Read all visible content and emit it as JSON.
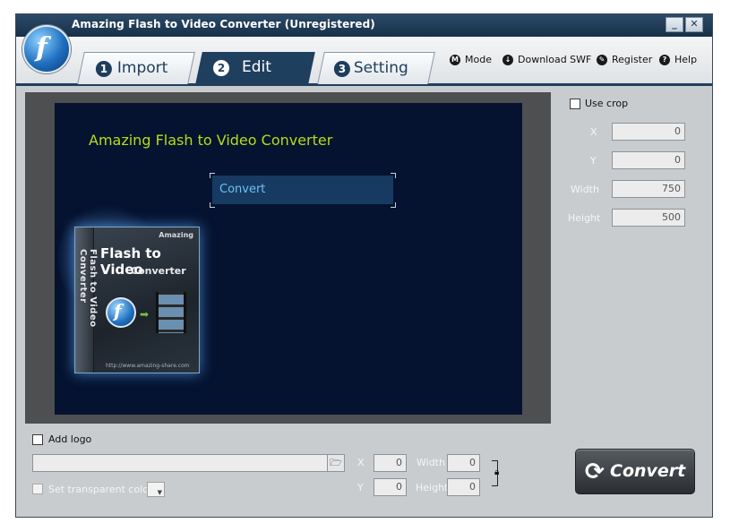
{
  "window": {
    "title": "Amazing Flash to Video Converter (Unregistered)",
    "minimize_label": "_",
    "close_label": "✕"
  },
  "tabs": [
    {
      "number": "1",
      "label": "Import"
    },
    {
      "number": "2",
      "label": "Edit"
    },
    {
      "number": "3",
      "label": "Setting"
    }
  ],
  "top_links": [
    {
      "icon": "M",
      "label": "Mode"
    },
    {
      "icon": "↓",
      "label": "Download SWF"
    },
    {
      "icon": "✎",
      "label": "Register"
    },
    {
      "icon": "?",
      "label": "Help"
    }
  ],
  "preview": {
    "stage_title": "Amazing Flash to Video Converter",
    "stage_button": "Convert",
    "box": {
      "spine": "Flash to Video Converter",
      "brand": "Amazing",
      "title": "Flash to Video",
      "subtitle": "Converter",
      "url": "http://www.amazing-share.com"
    }
  },
  "crop": {
    "use_crop_label": "Use crop",
    "x_label": "X",
    "x_value": "0",
    "y_label": "Y",
    "y_value": "0",
    "width_label": "Width",
    "width_value": "750",
    "height_label": "Height",
    "height_value": "500"
  },
  "logo": {
    "add_logo_label": "Add logo",
    "path_value": "",
    "transparent_label": "Set transparent color",
    "x_label": "X",
    "x_value": "0",
    "y_label": "Y",
    "y_value": "0",
    "width_label": "Width",
    "width_value": "0",
    "height_label": "Height",
    "height_value": "0"
  },
  "convert_button": {
    "label": "Convert",
    "icon": "refresh-icon"
  }
}
